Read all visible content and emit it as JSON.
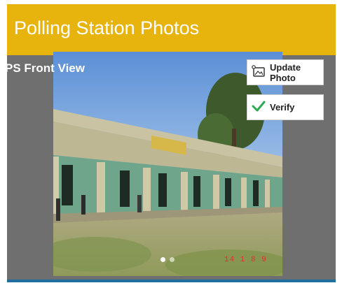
{
  "header": {
    "title": "Polling Station Photos"
  },
  "photo": {
    "label": "PS Front View",
    "stamp": "14 1 8 9"
  },
  "actions": {
    "update_label": "Update Photo",
    "verify_label": "Verify"
  },
  "carousel": {
    "count": 2,
    "active": 1
  },
  "colors": {
    "header": "#e7b30d",
    "panel": "#6f6f6f",
    "accent_bar": "#1f6f9e",
    "verify_check": "#2fa84f"
  },
  "icons": {
    "update": "photo-update-icon",
    "verify": "checkmark-icon"
  }
}
